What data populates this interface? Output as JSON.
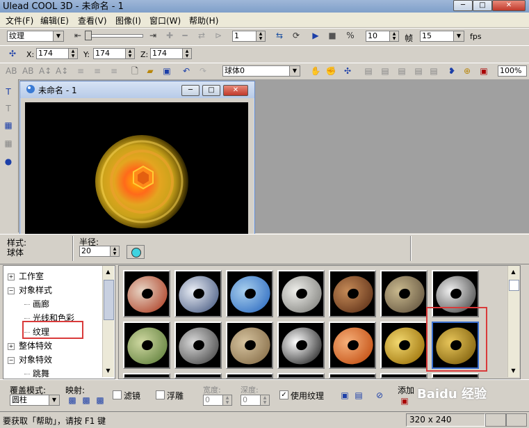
{
  "app": {
    "title": "Ulead COOL 3D - 未命名 - 1",
    "window_buttons": {
      "minimize": "─",
      "maximize": "□",
      "close": "✕"
    }
  },
  "menu": [
    "文件(F)",
    "编辑(E)",
    "查看(V)",
    "图像(I)",
    "窗口(W)",
    "帮助(H)"
  ],
  "toolbar1": {
    "category_select": "纹理",
    "frame_value": "1",
    "frames_total": "10",
    "frames_label": "帧",
    "fps_value": "15",
    "fps_label": "fps"
  },
  "toolbar2": {
    "x_label": "X:",
    "x_value": "174",
    "y_label": "Y:",
    "y_value": "174",
    "z_label": "Z:",
    "z_value": "174"
  },
  "toolbar3": {
    "object_select": "球体0",
    "zoom": "100%"
  },
  "document": {
    "title": "未命名 - 1"
  },
  "properties": {
    "style_label": "样式:",
    "style_value": "球体",
    "radius_label": "半径:",
    "radius_value": "20",
    "swatch_color": "#3fd3e0"
  },
  "tree": [
    {
      "label": "工作室",
      "expander": "+",
      "indent": 0
    },
    {
      "label": "对象样式",
      "expander": "−",
      "indent": 0
    },
    {
      "label": "画廊",
      "expander": "",
      "indent": 1
    },
    {
      "label": "光线和色彩",
      "expander": "",
      "indent": 1
    },
    {
      "label": "纹理",
      "expander": "",
      "indent": 1,
      "selected": true
    },
    {
      "label": "整体特效",
      "expander": "+",
      "indent": 0
    },
    {
      "label": "对象特效",
      "expander": "−",
      "indent": 0
    },
    {
      "label": "跳舞",
      "expander": "",
      "indent": 1
    }
  ],
  "gallery": {
    "thumbnails": [
      {
        "name": "brick",
        "c1": "#b5533a",
        "c2": "#e7d4c4"
      },
      {
        "name": "blue-marble",
        "c1": "#5e6f92",
        "c2": "#e9edf5"
      },
      {
        "name": "water-drops",
        "c1": "#3d78c6",
        "c2": "#a8cfee"
      },
      {
        "name": "stone-wall",
        "c1": "#8e8e8a",
        "c2": "#eeeeea"
      },
      {
        "name": "wicker",
        "c1": "#6a3b1f",
        "c2": "#c58a57"
      },
      {
        "name": "rock",
        "c1": "#6f6048",
        "c2": "#c9b98e"
      },
      {
        "name": "cracked-silver",
        "c1": "#5d5d5d",
        "c2": "#f0f0f0"
      },
      {
        "name": "green-moss",
        "c1": "#6d8a48",
        "c2": "#cfd8a1"
      },
      {
        "name": "granite",
        "c1": "#595959",
        "c2": "#d8d8d8"
      },
      {
        "name": "burlap",
        "c1": "#8f7752",
        "c2": "#d6c39f"
      },
      {
        "name": "chrome",
        "c1": "#3f3f3f",
        "c2": "#ffffff"
      },
      {
        "name": "orange-gloss",
        "c1": "#c8581c",
        "c2": "#f6b07a"
      },
      {
        "name": "gold-rough",
        "c1": "#a67d14",
        "c2": "#f2d870"
      },
      {
        "name": "gold-brushed",
        "c1": "#8a6a14",
        "c2": "#e7c55a"
      }
    ]
  },
  "bottom": {
    "cover_label": "覆盖模式:",
    "cover_value": "圆柱",
    "mapping_label": "映射:",
    "filter_label": "滤镜",
    "emboss_label": "浮雕",
    "width_label": "宽度:",
    "width_value": "0",
    "depth_label": "深度:",
    "depth_value": "0",
    "use_texture_label": "使用纹理",
    "add_label": "添加"
  },
  "status": {
    "help_text": "要获取「帮助」，请按 F1 键",
    "dimensions": "320 x 240"
  },
  "watermark": "Baidu 经验"
}
